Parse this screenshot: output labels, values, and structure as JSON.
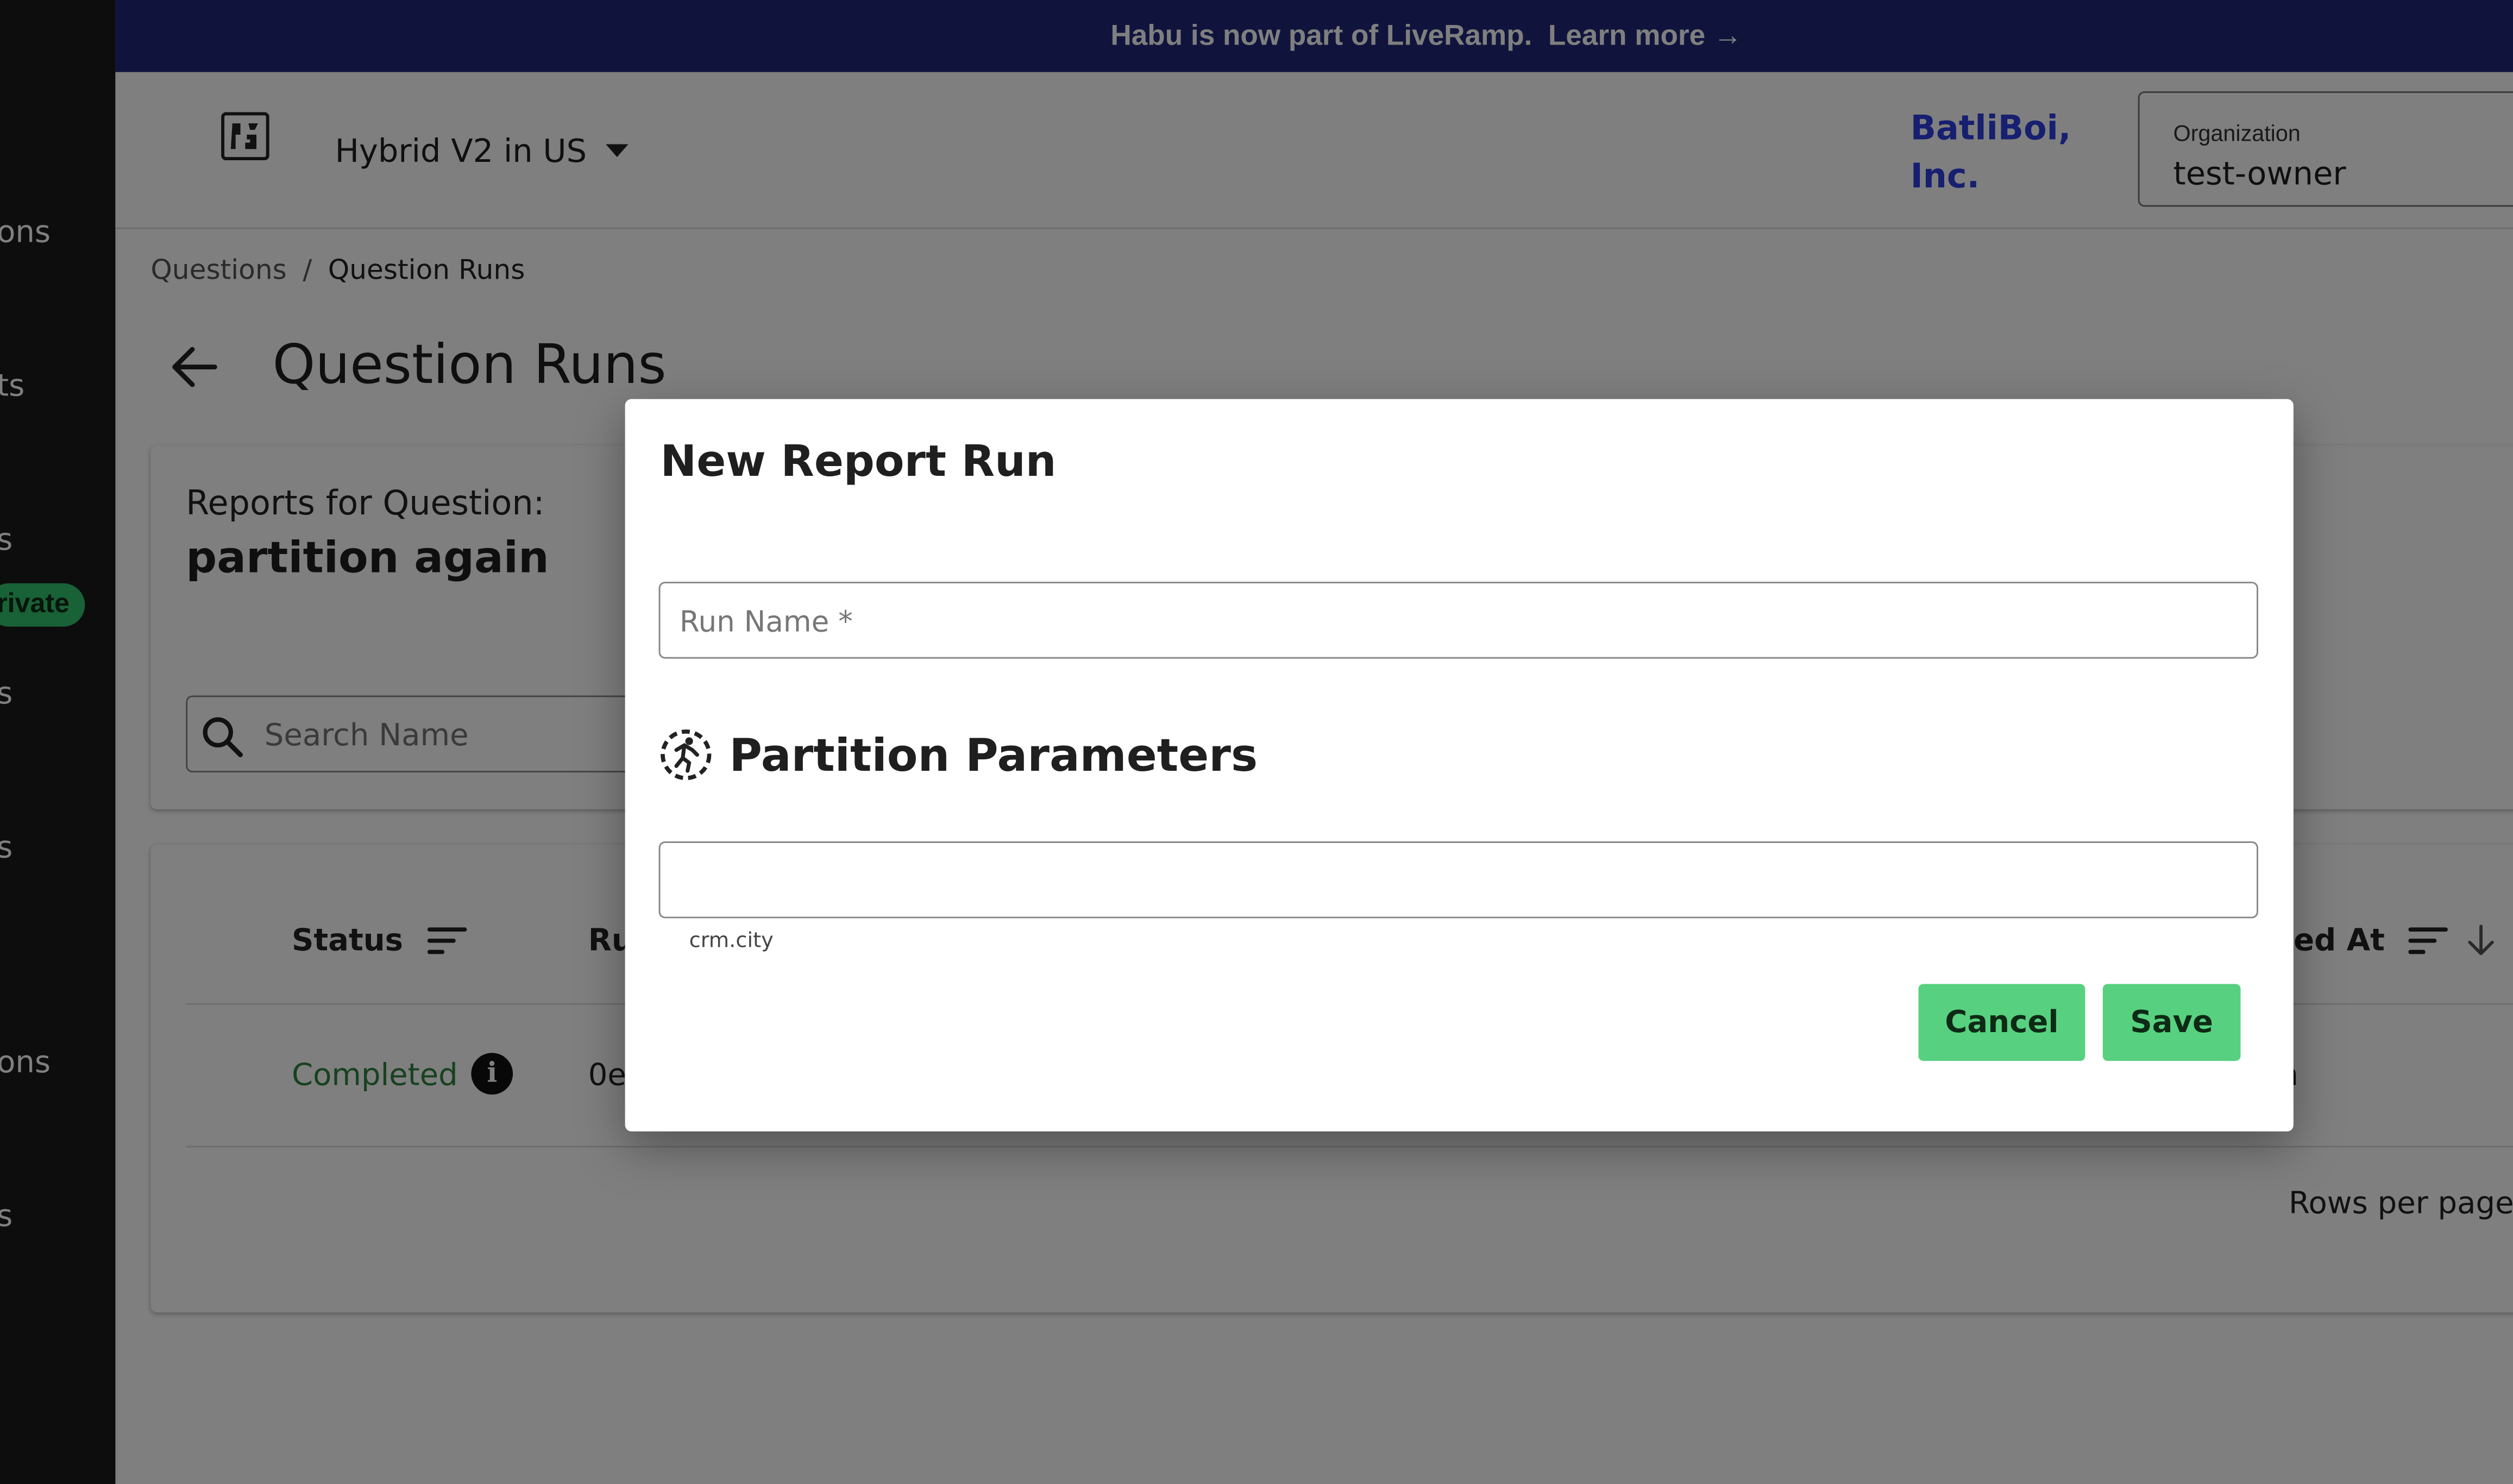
{
  "banner": {
    "text": "Habu is now part of LiveRamp.",
    "link": "Learn more →"
  },
  "sidebar": {
    "items": [
      "ons",
      "ts",
      "s",
      "s",
      "s",
      "ons",
      "s"
    ],
    "badge": "rivate"
  },
  "header": {
    "logo_glyph": "𝕳",
    "workspace": "Hybrid V2 in US",
    "org_display_line1": "BatliBoi,",
    "org_display_line2": "Inc.",
    "org_label": "Organization",
    "org_value": "test-owner"
  },
  "breadcrumb": {
    "parent": "Questions",
    "separator": "/",
    "current": "Question Runs"
  },
  "page": {
    "title": "Question Runs",
    "reports_for_label": "Reports for Question:",
    "question_name": "partition again",
    "search_placeholder": "Search Name"
  },
  "table": {
    "columns": {
      "status": "Status",
      "run_partial": "Ru",
      "created_partial": "ted At"
    },
    "rows": [
      {
        "status": "Completed",
        "info_glyph": "i",
        "run_partial": "0e",
        "created_partial": "n"
      }
    ],
    "rows_per_page_label": "Rows per page:"
  },
  "modal": {
    "title": "New Report Run",
    "run_name_placeholder": "Run Name *",
    "run_name_value": "",
    "section_title": "Partition Parameters",
    "param_value": "",
    "param_helper": "crm.city",
    "cancel_label": "Cancel",
    "save_label": "Save"
  },
  "colors": {
    "banner": "#21287a",
    "org_link": "#2d3ee0",
    "button": "#57d17f",
    "completed": "#2e8540",
    "badge": "#33c36c"
  }
}
